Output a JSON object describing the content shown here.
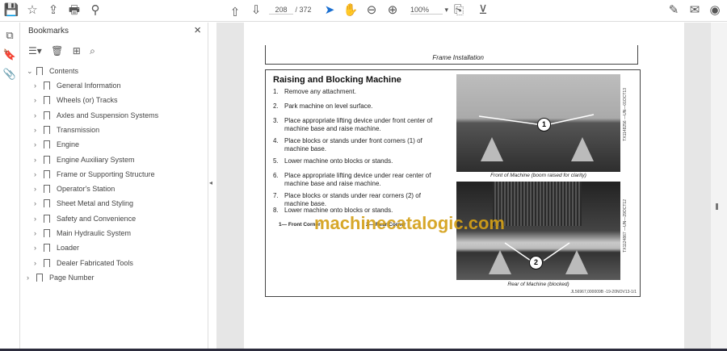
{
  "toolbar": {
    "page_current": "208",
    "page_total": "/ 372",
    "zoom": "100%"
  },
  "icons": {
    "save": "💾",
    "star": "☆",
    "upload": "⇪",
    "print": "🖶",
    "search": "⚲",
    "prev": "⊕",
    "next": "⊖",
    "select": "➤",
    "hand": "✋",
    "zoom_out": "⊖",
    "zoom_in": "⊕",
    "fit": "⎘",
    "scroll": "⊻",
    "sign": "✎",
    "mail": "✉",
    "account": "◉"
  },
  "bookmarks": {
    "title": "Bookmarks",
    "close": "×",
    "root": "Contents",
    "items": [
      "General Information",
      "Wheels (or) Tracks",
      "Axles and Suspension Systems",
      "Transmission",
      "Engine",
      "Engine Auxiliary System",
      "Frame or Supporting Structure",
      "Operator's Station",
      "Sheet Metal and Styling",
      "Safety and Convenience",
      "Main Hydraulic System",
      "Loader",
      "Dealer Fabricated Tools"
    ],
    "last": "Page Number"
  },
  "document": {
    "header": "Frame Installation",
    "heading": "Raising and Blocking Machine",
    "steps": [
      {
        "n": "1.",
        "t": "Remove any attachment."
      },
      {
        "n": "2.",
        "t": "Park machine on level surface."
      },
      {
        "n": "3.",
        "t": "Place appropriate lifting device under front center of machine base and raise machine."
      },
      {
        "n": "4.",
        "t": "Place blocks or stands under front corners (1) of machine base."
      },
      {
        "n": "5.",
        "t": "Lower machine onto blocks or stands."
      },
      {
        "n": "6.",
        "t": "Place appropriate lifting device under rear center of machine base and raise machine."
      },
      {
        "n": "7.",
        "t": "Place blocks or stands under rear corners (2) of machine base."
      },
      {
        "n": "8.",
        "t": "Lower machine onto blocks or stands."
      }
    ],
    "legend": [
      "1— Front Corner",
      "2— Rear Corner"
    ],
    "callouts": [
      "1",
      "2"
    ],
    "caption1": "Front of Machine (boom raised for clarity)",
    "caption2": "Rear of Machine (blocked)",
    "side1": "TX1148256 —UN—01OCT13",
    "side2": "TX1124867 —UN—29OCT12",
    "footer": "JL56967,000009B -19-20NOV13-1/1",
    "watermark": "machinecatalogic.com"
  }
}
